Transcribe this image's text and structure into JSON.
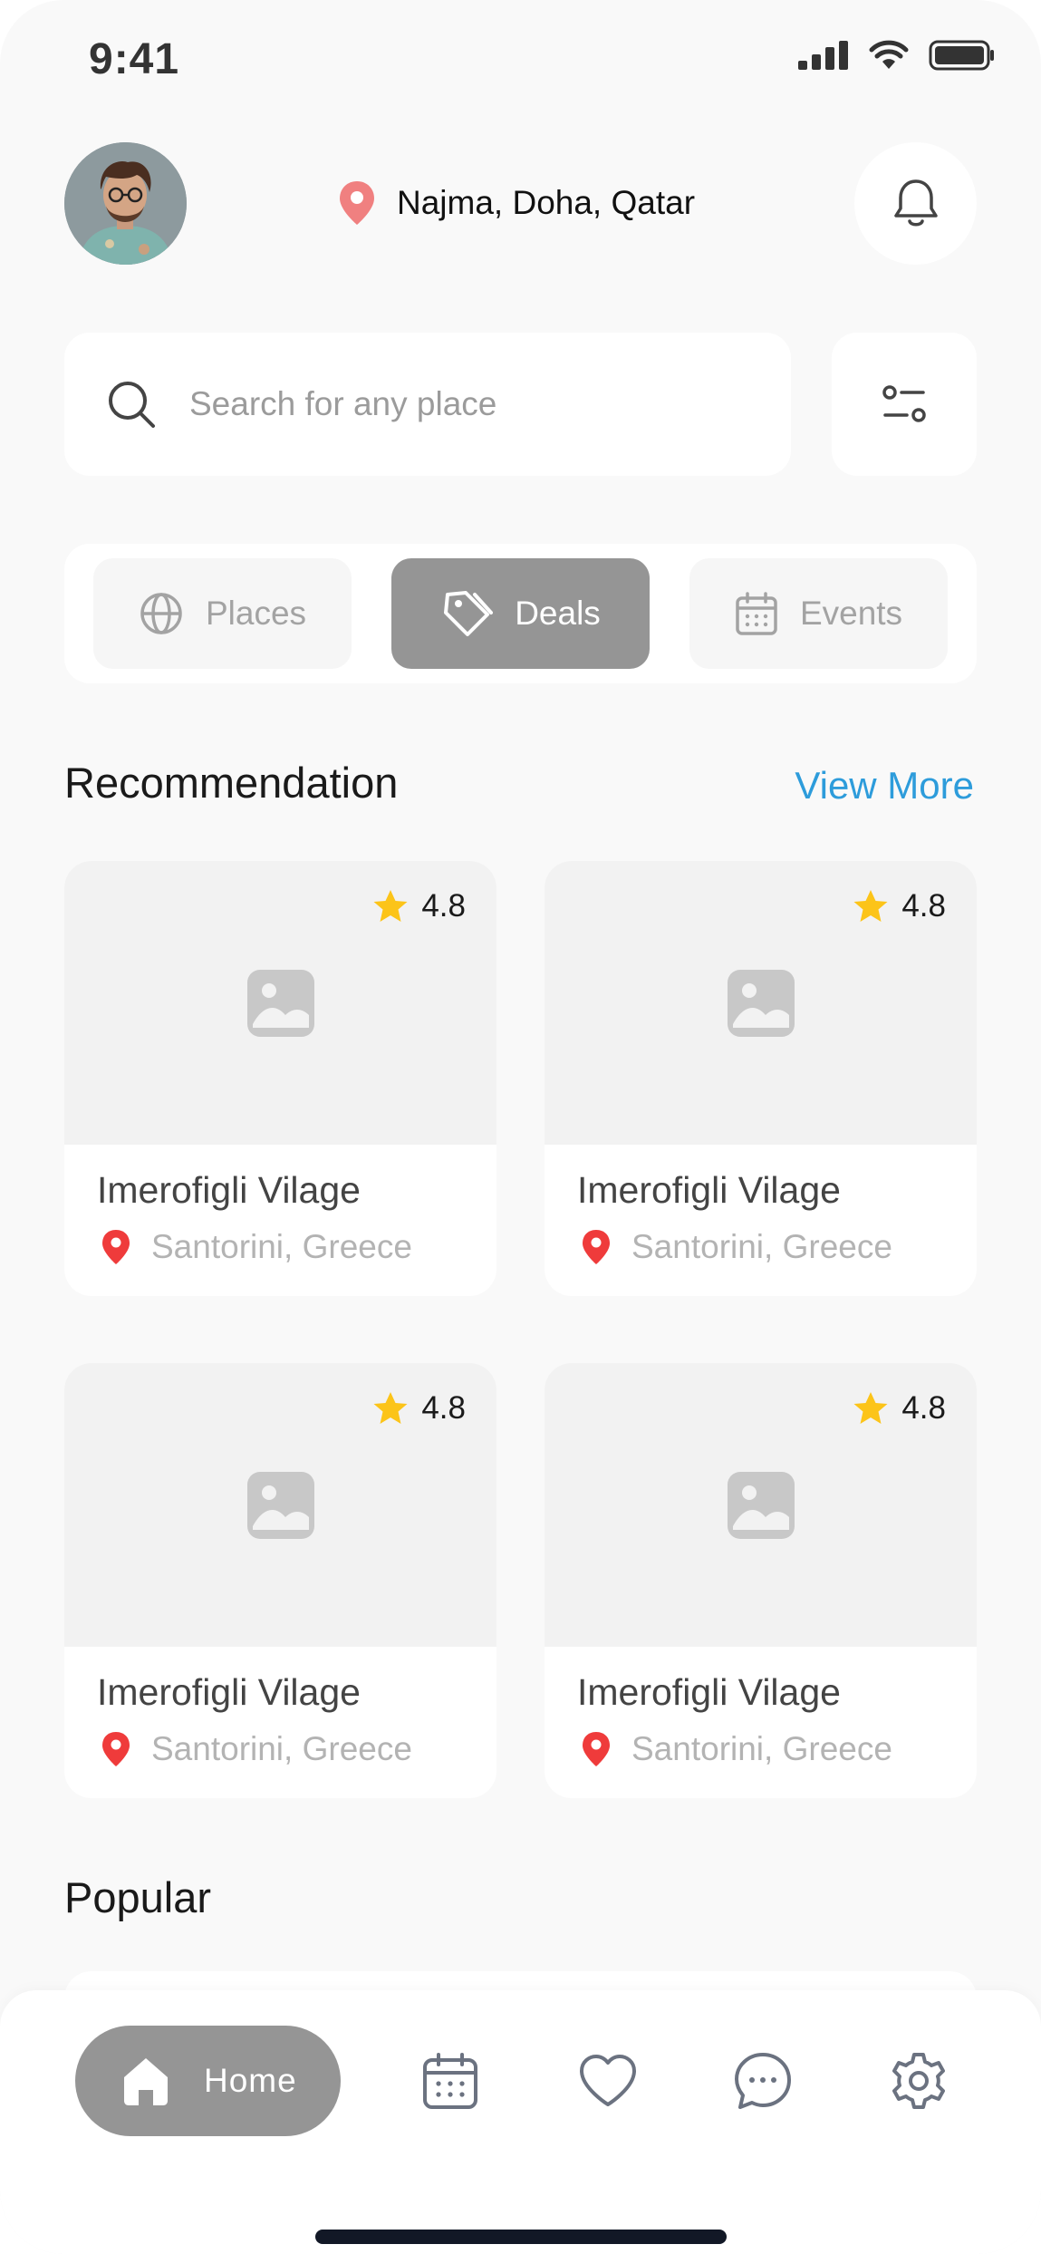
{
  "status_bar": {
    "time": "9:41"
  },
  "header": {
    "location": "Najma, Doha, Qatar"
  },
  "search": {
    "placeholder": "Search for any place"
  },
  "tabs": [
    {
      "label": "Places",
      "icon": "globe-icon",
      "active": false
    },
    {
      "label": "Deals",
      "icon": "tag-icon",
      "active": true
    },
    {
      "label": "Events",
      "icon": "calendar-icon",
      "active": false
    }
  ],
  "recommendation": {
    "title": "Recommendation",
    "view_more": "View More",
    "cards": [
      {
        "rating": "4.8",
        "title": "Imerofigli Vilage",
        "location": "Santorini, Greece"
      },
      {
        "rating": "4.8",
        "title": "Imerofigli Vilage",
        "location": "Santorini, Greece"
      },
      {
        "rating": "4.8",
        "title": "Imerofigli Vilage",
        "location": "Santorini, Greece"
      },
      {
        "rating": "4.8",
        "title": "Imerofigli Vilage",
        "location": "Santorini, Greece"
      }
    ]
  },
  "popular": {
    "title": "Popular"
  },
  "bottom_nav": {
    "home_label": "Home",
    "items": [
      "home-icon",
      "calendar-icon",
      "heart-icon",
      "chat-icon",
      "settings-icon"
    ]
  },
  "colors": {
    "accent_link": "#2d9cdb",
    "active_tab": "#959595",
    "pin_red": "#ef3b3b",
    "star_yellow": "#fcc419"
  }
}
